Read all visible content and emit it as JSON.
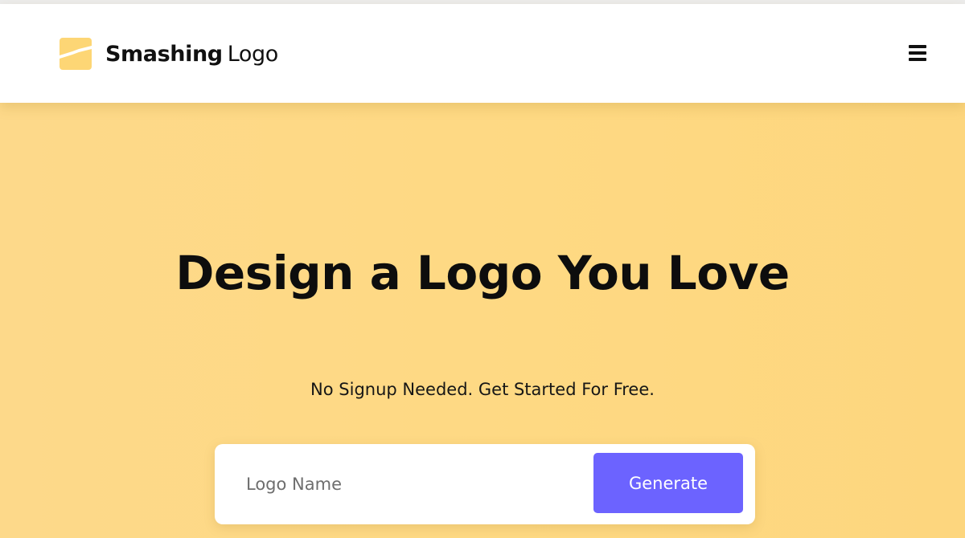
{
  "header": {
    "brand_bold": "Smashing",
    "brand_light": "Logo",
    "logo_icon": "smashing-logo-mark",
    "menu_icon": "hamburger-menu-icon"
  },
  "hero": {
    "headline": "Design a Logo You Love",
    "subline": "No Signup Needed. Get Started For Free.",
    "background_color": "#fdd985"
  },
  "form": {
    "input_placeholder": "Logo Name",
    "input_value": "",
    "generate_label": "Generate",
    "button_color": "#6c63ff"
  }
}
